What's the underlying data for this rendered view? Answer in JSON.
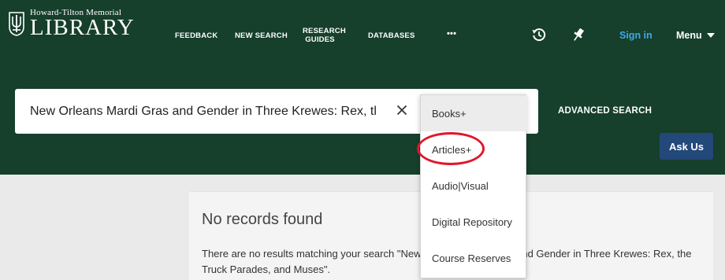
{
  "header": {
    "logo_small": "Howard-Tilton Memorial",
    "logo_big": "LIBRARY",
    "nav": [
      {
        "label": "FEEDBACK"
      },
      {
        "label": "NEW SEARCH"
      },
      {
        "label": "RESEARCH\nGUIDES"
      },
      {
        "label": "DATABASES"
      },
      {
        "label": "•••"
      }
    ],
    "signin": "Sign in",
    "menu": "Menu"
  },
  "search": {
    "value": "New Orleans Mardi Gras and Gender in Three Krewes: Rex, tl",
    "advanced": "ADVANCED SEARCH",
    "ask_us": "Ask Us"
  },
  "scope_dropdown": {
    "options": [
      "Books+",
      "Articles+",
      "Audio|Visual",
      "Digital Repository",
      "Course Reserves"
    ],
    "highlighted": "Books+",
    "annotated": "Articles+"
  },
  "results": {
    "title": "No records found",
    "message": "There are no results matching your search \"New Orleans Mardi Gras and Gender in Three Krewes: Rex, the Truck Parades, and Muses\"."
  },
  "colors": {
    "header_bg": "#163f2c",
    "signin": "#3fa9e8",
    "ask_us_bg": "#23487a",
    "annotation": "#e1162b"
  }
}
